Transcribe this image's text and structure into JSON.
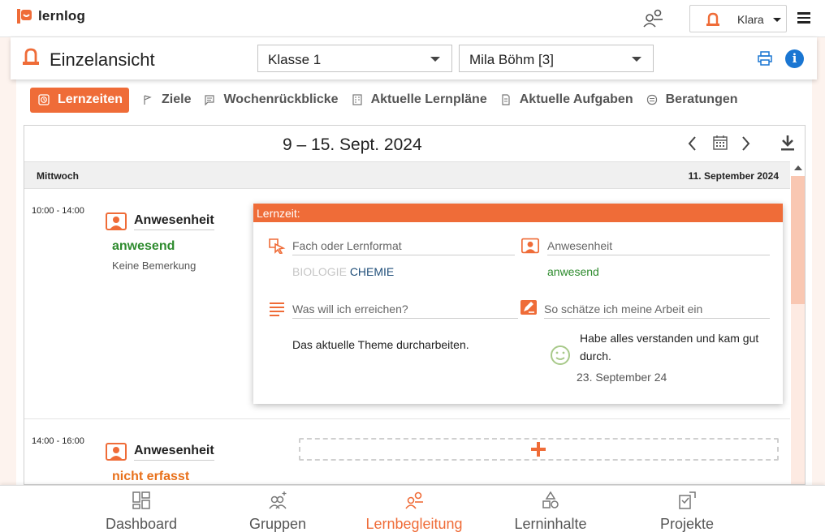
{
  "app": {
    "name": "lernlog"
  },
  "user": {
    "name": "Klara"
  },
  "header": {
    "title": "Einzelansicht",
    "class_select": "Klasse 1",
    "student_select": "Mila Böhm [3]"
  },
  "tabs": [
    {
      "label": "Lernzeiten",
      "icon": "clock-icon",
      "active": true
    },
    {
      "label": "Ziele",
      "icon": "flag-icon"
    },
    {
      "label": "Wochenrückblicke",
      "icon": "comment-icon"
    },
    {
      "label": "Aktuelle Lernpläne",
      "icon": "plan-icon"
    },
    {
      "label": "Aktuelle Aufgaben",
      "icon": "task-icon"
    },
    {
      "label": "Beratungen",
      "icon": "chat-icon"
    }
  ],
  "week": {
    "title": "9 – 15. Sept. 2024",
    "day_name": "Mittwoch",
    "day_date": "11. September 2024"
  },
  "slots": [
    {
      "time": "10:00 - 14:00",
      "title": "Anwesenheit",
      "status": "anwesend",
      "note": "Keine Bemerkung"
    },
    {
      "time": "14:00 - 16:00",
      "title": "Anwesenheit",
      "status": "nicht erfasst"
    }
  ],
  "popover": {
    "title": "Lernzeit:",
    "subject_label": "Fach oder Lernformat",
    "subject_inactive": "BIOLOGIE",
    "subject_active": "CHEMIE",
    "attendance_label": "Anwesenheit",
    "attendance_value": "anwesend",
    "goal_label": "Was will ich erreichen?",
    "goal_value": "Das aktuelle Theme durcharbeiten.",
    "assessment_label": "So schätze ich meine Arbeit ein",
    "assessment_text": "Habe alles verstanden und kam gut durch.",
    "assessment_date": "23. September 24"
  },
  "bottom_nav": [
    {
      "label": "Dashboard",
      "icon": "dashboard-icon"
    },
    {
      "label": "Gruppen",
      "icon": "groups-icon"
    },
    {
      "label": "Lernbegleitung",
      "icon": "learning-support-icon",
      "active": true
    },
    {
      "label": "Lerninhalte",
      "icon": "learning-content-icon"
    },
    {
      "label": "Projekte",
      "icon": "projects-icon"
    }
  ],
  "colors": {
    "accent": "#ef6c38",
    "present": "#2e8b2e",
    "not_recorded": "#e8701a",
    "info": "#1a76d2"
  }
}
